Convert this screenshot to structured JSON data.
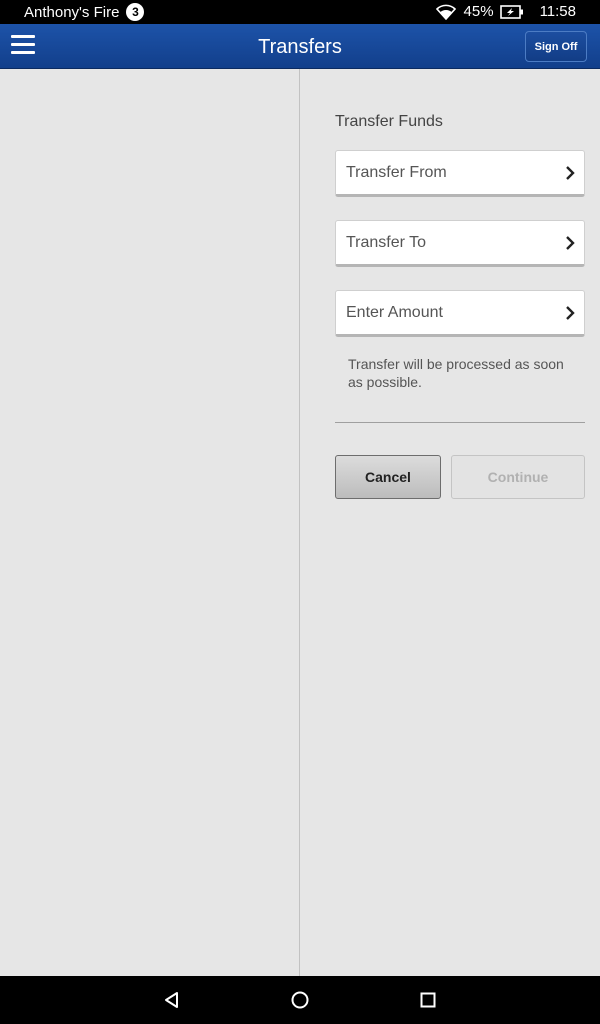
{
  "status_bar": {
    "notification_text": "Anthony's Fire",
    "notification_count": "3",
    "battery_percent": "45%",
    "time": "11:58",
    "icons": [
      "wifi-icon",
      "battery-charging-icon"
    ]
  },
  "header": {
    "title": "Transfers",
    "sign_off_label": "Sign Off",
    "menu_icon": "hamburger-menu-icon",
    "brand_color": "#1a4c9e"
  },
  "transfer": {
    "section_title": "Transfer Funds",
    "fields": [
      {
        "label": "Transfer From"
      },
      {
        "label": "Transfer To"
      },
      {
        "label": "Enter Amount"
      }
    ],
    "note": "Transfer will be processed as soon as possible.",
    "cancel_label": "Cancel",
    "continue_label": "Continue",
    "continue_enabled": false
  },
  "nav_bar": {
    "icons": [
      "back-triangle-icon",
      "home-circle-icon",
      "recent-apps-square-icon"
    ]
  }
}
